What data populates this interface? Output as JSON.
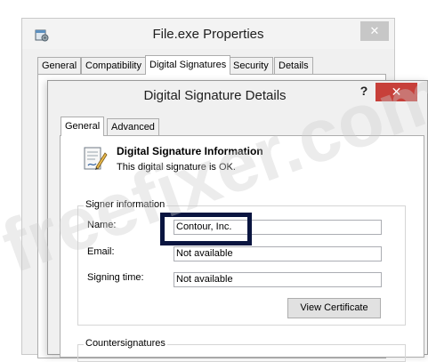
{
  "outer_window": {
    "title": "File.exe Properties",
    "close_glyph": "✕",
    "tabs": [
      {
        "label": "General",
        "active": false
      },
      {
        "label": "Compatibility",
        "active": false
      },
      {
        "label": "Digital Signatures",
        "active": true
      },
      {
        "label": "Security",
        "active": false
      },
      {
        "label": "Details",
        "active": false
      }
    ]
  },
  "dialog": {
    "title": "Digital Signature Details",
    "help_glyph": "?",
    "close_glyph": "✕",
    "tabs": [
      {
        "label": "General",
        "active": true
      },
      {
        "label": "Advanced",
        "active": false
      }
    ],
    "info": {
      "heading": "Digital Signature Information",
      "status": "This digital signature is OK."
    },
    "signer_group": {
      "legend": "Signer information",
      "name_label": "Name:",
      "name_value": "Contour, Inc.",
      "email_label": "Email:",
      "email_value": "Not available",
      "signing_time_label": "Signing time:",
      "signing_time_value": "Not available",
      "view_certificate_label": "View Certificate"
    },
    "countersignatures_group": {
      "legend": "Countersignatures"
    }
  },
  "watermark": "freefixer.com",
  "colors": {
    "dialog_close": "#c7403a",
    "highlight_border": "#0a1540",
    "outer_close": "#c7c7c7"
  }
}
